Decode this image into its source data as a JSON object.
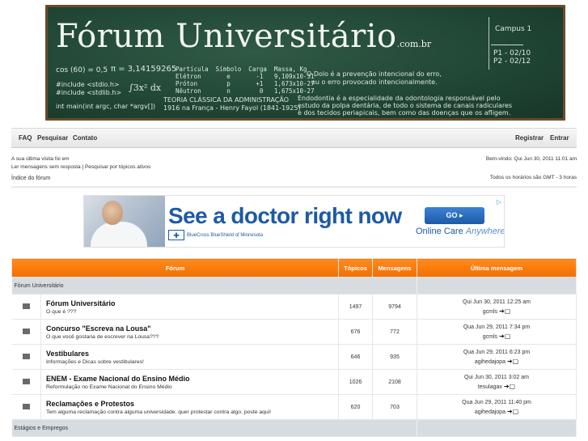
{
  "banner": {
    "title": "Fórum Universitário",
    "tld": ".com.br",
    "campus": "Campus 1",
    "p1": "P1 - 02/10",
    "p2": "P2 - 02/12",
    "math": "cos (60) = 0,5",
    "pi": "π = 3,14159265",
    "include1": "#include <stdio.h>",
    "include2": "#include <stdlib.h>",
    "integral": "∫3x² dx",
    "intmain": "int main(int argc, char *argv[])",
    "particles": "Partícula  Símbolo  Carga  Massa, Kg\nElétron       e       -1   9,109x10-31\nPróton        p       +1   1,673x10-27\nNêutron       n        0   1,675x10-27",
    "teoria": "TEORIA CLÁSSICA DA ADMINISTRAÇÃO",
    "teoria2": "1916 na França - Henry Fayol (1841-1925)",
    "dolo": "O Dolo é a prevenção intencional do erro,",
    "dolo2": "ou o erro provocado intencionalmente.",
    "endo1": "Endodontia é a especialidade da odontologia responsável pelo",
    "endo2": "estudo da polpa dentária, de todo o sistema de canais radiculares",
    "endo3": "e dos tecidos periapicais, bem como das doenças que os afligem."
  },
  "nav": {
    "faq": "FAQ",
    "search": "Pesquisar",
    "contact": "Contato",
    "register": "Registrar",
    "login": "Entrar"
  },
  "info": {
    "last_visit": "A sua última visita foi em",
    "welcome": "Bem-vindo: Qui Jun 30, 2011 11:01 am",
    "unanswered": "Ler mensagens sem resposta",
    "separator": "|",
    "active": "Pesquisar por tópicos ativos",
    "index": "Índice do fórum",
    "timezone": "Todos os horários são GMT - 3 horas"
  },
  "ad": {
    "headline": "See a doctor right now",
    "bcbs": "BlueCross BlueShield of Minnesota",
    "go": "GO ▸",
    "online": "Online Care",
    "anywhere": "Anywhere®",
    "adchoice": "▷"
  },
  "table": {
    "col_forum": "Fórum",
    "col_topics": "Tópicos",
    "col_posts": "Mensagens",
    "col_last": "Última mensagem",
    "categories": [
      {
        "name": "Fórum Universitário",
        "forums": [
          {
            "name": "Fórum Universitário",
            "desc": "O que é ???",
            "topics": "1497",
            "posts": "9794",
            "last_date": "Qui Jun 30, 2011 12:25 am",
            "last_author": "gcmls"
          },
          {
            "name": "Concurso \"Escreva na Lousa\"",
            "desc": "O que você gostaria de escrever na Lousa???",
            "topics": "676",
            "posts": "772",
            "last_date": "Qua Jun 29, 2011 7:34 pm",
            "last_author": "gcmls"
          },
          {
            "name": "Vestibulares",
            "desc": "Informações e Dicas sobre vestibulares!",
            "topics": "646",
            "posts": "935",
            "last_date": "Qua Jun 29, 2011 6:23 pm",
            "last_author": "agihedajopa"
          },
          {
            "name": "ENEM - Exame Nacional do Ensino Médio",
            "desc": "Reformulação no Exame Nacional do Ensino Médio",
            "topics": "1026",
            "posts": "2108",
            "last_date": "Qui Jun 30, 2011 3:02 am",
            "last_author": "tesulagax"
          },
          {
            "name": "Reclamações e Protestos",
            "desc": "Tem alguma reclamação contra alguma universidade. quer protestar contra algo. poste aqui!",
            "topics": "620",
            "posts": "703",
            "last_date": "Qua Jun 29, 2011 11:40 pm",
            "last_author": "agihedajopa"
          }
        ]
      },
      {
        "name": "Estágios e Empregos",
        "forums": []
      }
    ]
  },
  "icons": {
    "folder": "forum-folder-icon",
    "go_last": "view-latest-post-icon",
    "goto_symbol": "➜▢"
  },
  "colors": {
    "header_orange": "#f26f00",
    "category_gray": "#d7dce0",
    "chalkboard": "#204535",
    "ad_blue": "#1d5aa6"
  }
}
